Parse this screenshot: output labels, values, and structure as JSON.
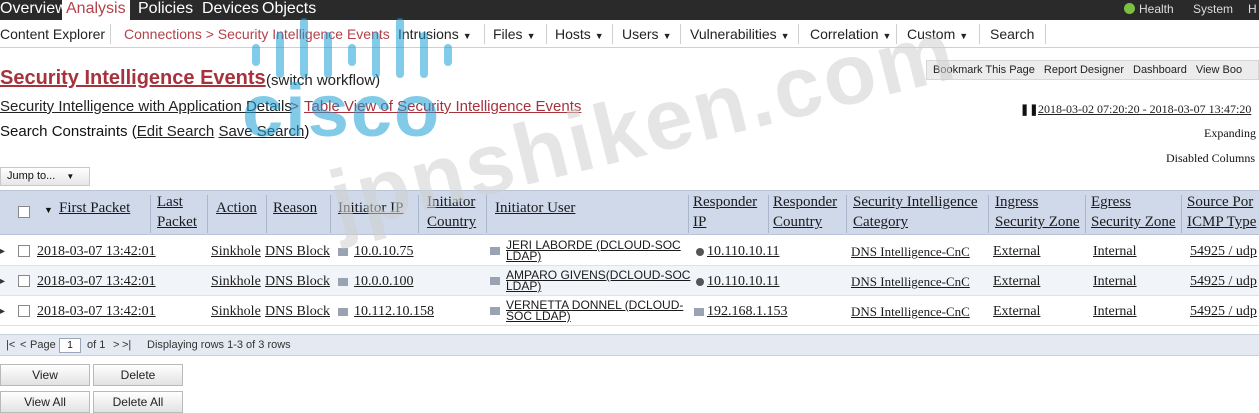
{
  "top_nav": {
    "items": [
      "Overview",
      "Analysis",
      "Policies",
      "Devices",
      "Objects"
    ],
    "active": "Analysis",
    "right": [
      "Health",
      "System",
      "H"
    ]
  },
  "sub_nav": {
    "items": [
      {
        "label": "Content Explorer",
        "dropdown": false
      },
      {
        "label": "Connections > Security Intelligence Events",
        "dropdown": false
      },
      {
        "label": "Intrusions",
        "dropdown": true
      },
      {
        "label": "Files",
        "dropdown": true
      },
      {
        "label": "Hosts",
        "dropdown": true
      },
      {
        "label": "Users",
        "dropdown": true
      },
      {
        "label": "Vulnerabilities",
        "dropdown": true
      },
      {
        "label": "Correlation",
        "dropdown": true
      },
      {
        "label": "Custom",
        "dropdown": true
      },
      {
        "label": "Search",
        "dropdown": false
      }
    ],
    "active_index": 1
  },
  "page": {
    "title": "Security Intelligence Events",
    "switch_workflow": "(switch workflow)",
    "bookmark_links": [
      "Bookmark This Page",
      "Report Designer",
      "Dashboard",
      "View Boo"
    ],
    "breadcrumb_1": "Security Intelligence with Application Details",
    "breadcrumb_arrow": ">",
    "breadcrumb_2": "Table View of Security Intelligence Events",
    "constraints_prefix": "Search Constraints (",
    "edit_search": "Edit Search",
    "save_search": "Save Search",
    "constraints_suffix": ")",
    "time_range": "2018-03-02 07:20:20 - 2018-03-07 13:47:20",
    "expanding": "Expanding",
    "disabled_columns": "Disabled Columns",
    "jump_to": "Jump to..."
  },
  "table": {
    "headers": {
      "first_packet": "First Packet",
      "last_packet_1": "Last",
      "last_packet_2": "Packet",
      "action": "Action",
      "reason": "Reason",
      "initiator_ip": "Initiator IP",
      "initiator_country_1": "Initiator",
      "initiator_country_2": "Country",
      "initiator_user": "Initiator User",
      "responder_ip_1": "Responder",
      "responder_ip_2": "IP",
      "responder_country_1": "Responder",
      "responder_country_2": "Country",
      "si_category_1": "Security Intelligence",
      "si_category_2": "Category",
      "ingress_zone_1": "Ingress",
      "ingress_zone_2": "Security Zone",
      "egress_zone_1": "Egress",
      "egress_zone_2": "Security Zone",
      "source_port_1": "Source Por",
      "source_port_2": "ICMP Type"
    },
    "rows": [
      {
        "first_packet": "2018-03-07 13:42:01",
        "action": "Sinkhole",
        "reason": "DNS Block",
        "initiator_ip": "10.0.10.75",
        "initiator_user_1": "JERI LABORDE (DCLOUD-SOC",
        "initiator_user_2": "LDAP)",
        "responder_ip": "10.110.10.11",
        "si_category": "DNS Intelligence-CnC",
        "ingress_zone": "External",
        "egress_zone": "Internal",
        "source_port": "54925 / udp"
      },
      {
        "first_packet": "2018-03-07 13:42:01",
        "action": "Sinkhole",
        "reason": "DNS Block",
        "initiator_ip": "10.0.0.100",
        "initiator_user_1": "AMPARO GIVENS(DCLOUD-SOC",
        "initiator_user_2": "LDAP)",
        "responder_ip": "10.110.10.11",
        "si_category": "DNS Intelligence-CnC",
        "ingress_zone": "External",
        "egress_zone": "Internal",
        "source_port": "54925 / udp"
      },
      {
        "first_packet": "2018-03-07 13:42:01",
        "action": "Sinkhole",
        "reason": "DNS Block",
        "initiator_ip": "10.112.10.158",
        "initiator_user_1": "VERNETTA DONNEL (DCLOUD-",
        "initiator_user_2": "SOC LDAP)",
        "responder_ip": "192.168.1.153",
        "si_category": "DNS Intelligence-CnC",
        "ingress_zone": "External",
        "egress_zone": "Internal",
        "source_port": "54925 / udp"
      }
    ]
  },
  "pager": {
    "first": "|<",
    "prev": "<",
    "page_label": "Page",
    "page_value": "1",
    "of_label": "of 1",
    "next": ">",
    "last": ">|",
    "displaying": "Displaying rows 1-3 of 3 rows"
  },
  "actions": {
    "view": "View",
    "delete": "Delete",
    "view_all": "View All",
    "delete_all": "Delete All"
  },
  "watermarks": {
    "cisco": "cisco",
    "site": "jpnshiken.com"
  },
  "colors": {
    "accent": "#a8323c",
    "header_row": "#cfd9ea",
    "topbar": "#2a2a2a",
    "cisco_blue": "#1ba0d7"
  }
}
